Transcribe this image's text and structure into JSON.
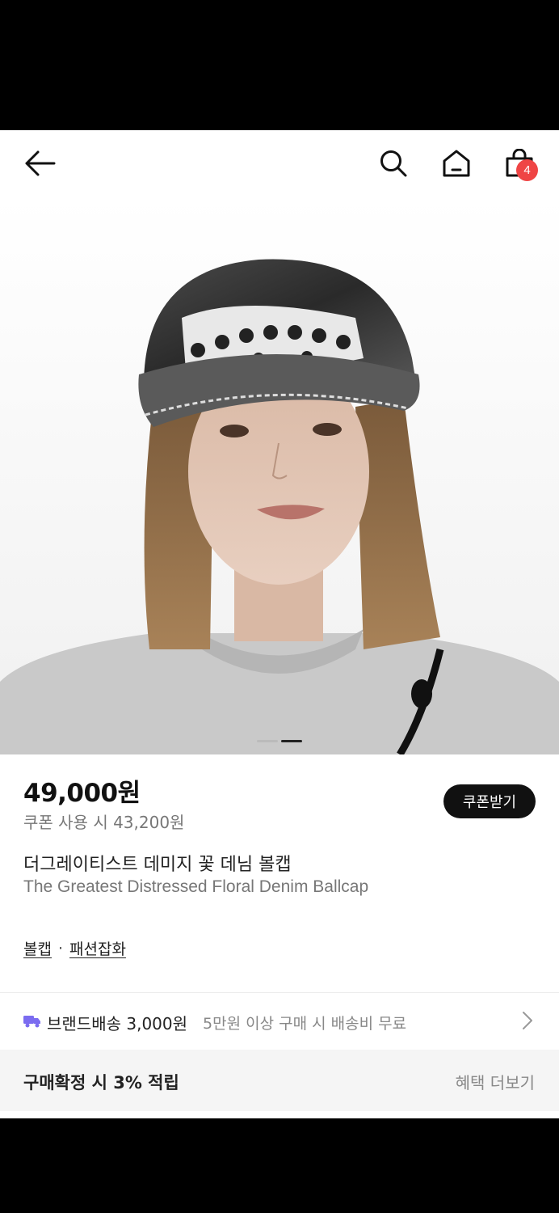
{
  "header": {
    "back_icon": "arrow-left-icon",
    "search_icon": "search-icon",
    "home_icon": "home-icon",
    "bag_icon": "shopping-bag-icon",
    "cart_count": "4"
  },
  "product": {
    "price": "49,000원",
    "coupon_price": "쿠폰 사용 시 43,200원",
    "coupon_button": "쿠폰받기",
    "name_ko": "더그레이티스트 데미지 꽃 데님 볼캡",
    "name_en": "The Greatest Distressed Floral Denim Ballcap",
    "categories": [
      "볼캡",
      "패션잡화"
    ],
    "category_separator": "·"
  },
  "shipping": {
    "icon": "truck-icon",
    "title": "브랜드배송 3,000원",
    "note": "5만원 이상 구매 시 배송비 무료"
  },
  "benefit": {
    "title": "구매확정 시 3% 적립",
    "more": "혜택 더보기"
  },
  "image_indicator": {
    "count": 2,
    "active": 2
  },
  "colors": {
    "accent": "#ef4545",
    "shipping_icon": "#7b6cf0",
    "button_bg": "#111111"
  }
}
